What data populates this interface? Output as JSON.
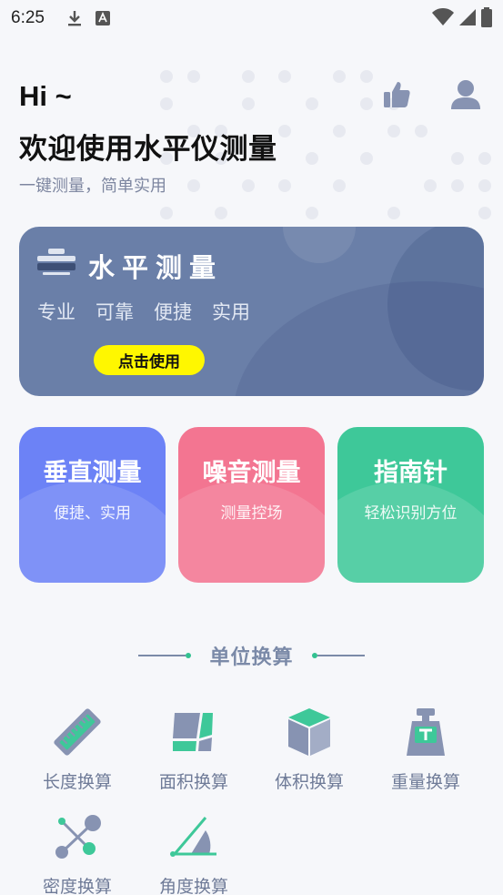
{
  "status_bar": {
    "time": "6:25"
  },
  "header": {
    "greeting": "Hi ~",
    "title": "欢迎使用水平仪测量",
    "subtitle": "一键测量，简单实用"
  },
  "hero": {
    "title": "水平测量",
    "tags": [
      "专业",
      "可靠",
      "便捷",
      "实用"
    ],
    "button_label": "点击使用",
    "color": "#6a7fa8"
  },
  "features": [
    {
      "title": "垂直测量",
      "subtitle": "便捷、实用",
      "color": "#6c82f6"
    },
    {
      "title": "噪音测量",
      "subtitle": "测量控场",
      "color": "#f37591"
    },
    {
      "title": "指南针",
      "subtitle": "轻松识别方位",
      "color": "#3ec899"
    }
  ],
  "unit_section": {
    "title": "单位换算",
    "items": [
      {
        "label": "长度换算",
        "icon": "ruler-icon"
      },
      {
        "label": "面积换算",
        "icon": "area-icon"
      },
      {
        "label": "体积换算",
        "icon": "cube-icon"
      },
      {
        "label": "重量换算",
        "icon": "weight-icon"
      },
      {
        "label": "密度换算",
        "icon": "density-icon"
      },
      {
        "label": "角度换算",
        "icon": "angle-icon"
      }
    ]
  },
  "colors": {
    "accent_green": "#32c190",
    "icon_gray": "#8793b2",
    "text_muted": "#7b8aa8"
  }
}
